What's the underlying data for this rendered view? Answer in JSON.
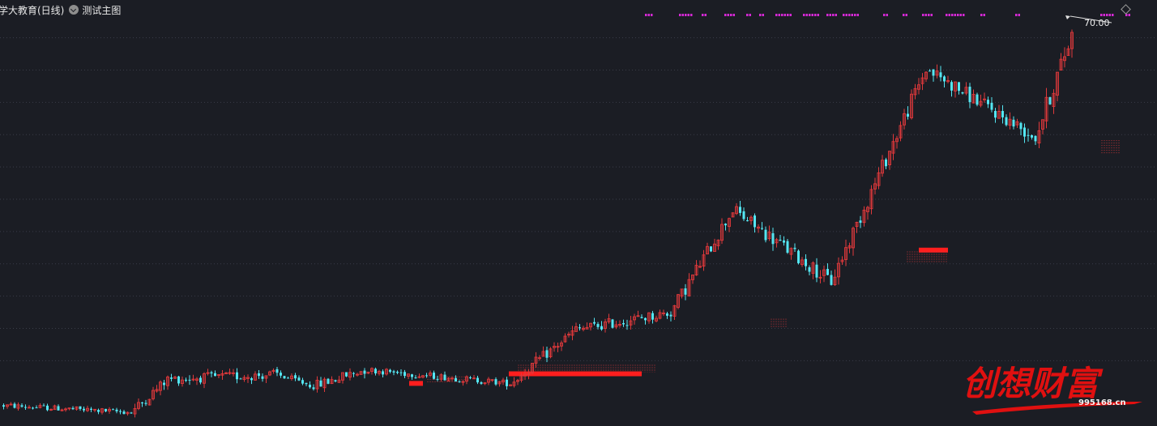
{
  "header": {
    "title": "学大教育(日线)",
    "indicator_label": "测试主图"
  },
  "watermark": {
    "brand": "创想财富",
    "site": "995168.cn"
  },
  "colors": {
    "background": "#1b1d24",
    "grid": "#3a3d48",
    "up": "#e0393b",
    "down": "#54e6f2",
    "signal": "#d629d6",
    "band": "#ff1e1e",
    "brand": "#e01010"
  },
  "chart_data": {
    "type": "candlestick",
    "title": "学大教育(日线)",
    "indicator": "测试主图",
    "annotations": [
      {
        "label": "70.00",
        "value": 70.0,
        "at": "last high"
      }
    ],
    "grid": true,
    "ylim": [
      10,
      72
    ],
    "gridlines": [
      66.5,
      61.8,
      57.1,
      52.4,
      47.7,
      43.0,
      38.3,
      33.6,
      28.9,
      24.2,
      19.5
    ],
    "segments": [
      {
        "name": "base",
        "candles": 36,
        "from": 13.0,
        "to": 12.0,
        "vol": 0.5
      },
      {
        "name": "rise1",
        "candles": 10,
        "from": 12.0,
        "to": 16.8,
        "vol": 0.9
      },
      {
        "name": "plateau1",
        "candles": 30,
        "from": 16.8,
        "to": 17.5,
        "vol": 0.9
      },
      {
        "name": "dip1",
        "candles": 10,
        "from": 17.5,
        "to": 15.8,
        "vol": 0.6
      },
      {
        "name": "bump1",
        "candles": 14,
        "from": 15.8,
        "to": 18.2,
        "vol": 0.9
      },
      {
        "name": "flat1",
        "candles": 40,
        "from": 18.2,
        "to": 16.2,
        "vol": 0.6
      },
      {
        "name": "rise2",
        "candles": 18,
        "from": 16.2,
        "to": 24.0,
        "vol": 1.0
      },
      {
        "name": "drift2",
        "candles": 26,
        "from": 24.0,
        "to": 26.5,
        "vol": 1.0
      },
      {
        "name": "surge3",
        "candles": 17,
        "from": 26.5,
        "to": 41.5,
        "vol": 1.3
      },
      {
        "name": "fall3",
        "candles": 27,
        "from": 41.5,
        "to": 31.0,
        "vol": 1.3
      },
      {
        "name": "surge4",
        "candles": 26,
        "from": 31.0,
        "to": 62.0,
        "vol": 1.5
      },
      {
        "name": "fall4",
        "candles": 30,
        "from": 62.0,
        "to": 52.0,
        "vol": 1.3
      },
      {
        "name": "finale",
        "candles": 10,
        "from": 52.0,
        "to": 67.0,
        "vol": 1.8
      }
    ],
    "signal_runs": [
      [
        796,
        803
      ],
      [
        838,
        854
      ],
      [
        866,
        872
      ],
      [
        894,
        905
      ],
      [
        921,
        927
      ],
      [
        937,
        941
      ],
      [
        957,
        977
      ],
      [
        991,
        1010
      ],
      [
        1020,
        1032
      ],
      [
        1040,
        1059
      ],
      [
        1090,
        1094
      ],
      [
        1114,
        1118
      ],
      [
        1138,
        1150
      ],
      [
        1167,
        1190
      ],
      [
        1210,
        1214
      ],
      [
        1253,
        1257
      ],
      [
        1358,
        1372
      ],
      [
        1389,
        1393
      ]
    ],
    "bands": [
      {
        "x": [
          505,
          522
        ],
        "value": 16.2
      },
      {
        "x": [
          628,
          792
        ],
        "value": 17.6
      },
      {
        "x": [
          1134,
          1170
        ],
        "value": 35.6
      }
    ],
    "dotted_clusters": [
      {
        "x": [
          528,
          578
        ],
        "from": 16.2,
        "to": 17.2
      },
      {
        "x": [
          640,
          810
        ],
        "from": 17.8,
        "to": 18.9
      },
      {
        "x": [
          952,
          970
        ],
        "from": 24.4,
        "to": 25.6
      },
      {
        "x": [
          1120,
          1170
        ],
        "from": 33.8,
        "to": 35.4
      },
      {
        "x": [
          1360,
          1382
        ],
        "from": 49.6,
        "to": 51.6
      }
    ]
  }
}
